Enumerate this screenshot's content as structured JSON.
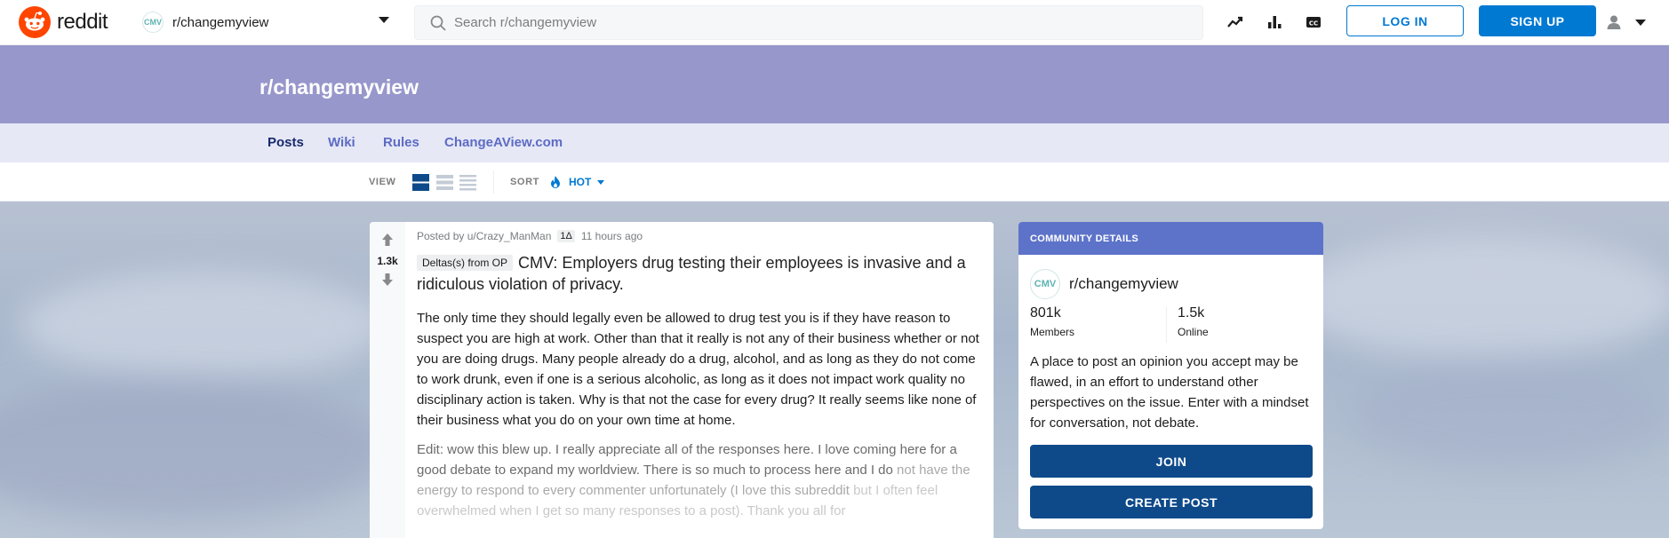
{
  "header": {
    "logo_text": "reddit",
    "community_name": "r/changemyview",
    "community_mini_logo": "CMV",
    "search_placeholder": "Search r/changemyview",
    "icons": [
      "trending-icon",
      "stats-icon",
      "closed-captions-icon"
    ],
    "login_label": "LOG IN",
    "signup_label": "SIGN UP"
  },
  "banner": {
    "title": "r/changemyview",
    "color": "#9797cc"
  },
  "subnav": {
    "tabs": [
      {
        "label": "Posts",
        "active": true
      },
      {
        "label": "Wiki",
        "active": false
      },
      {
        "label": "Rules",
        "active": false
      },
      {
        "label": "ChangeAView.com",
        "active": false
      }
    ]
  },
  "viewbar": {
    "view_label": "VIEW",
    "sort_label": "SORT",
    "sort_value": "HOT"
  },
  "post": {
    "votes": "1.3k",
    "posted_by": "Posted by u/Crazy_ManMan",
    "user_flair": "1Δ",
    "time": "11 hours ago",
    "flair": "Deltas(s) from OP",
    "title": "CMV: Employers drug testing their employees is invasive and a ridiculous violation of privacy.",
    "body_p1": "The only time they should legally even be allowed to drug test you is if they have reason to suspect you are high at work. Other than that it really is not any of their business whether or not you are doing drugs. Many people already do a drug, alcohol, and as long as they do not come to work drunk, even if one is a serious alcoholic, as long as it does not impact work quality no disciplinary action is taken. Why is that not the case for every drug? It really seems like none of their business what you do on your own time at home.",
    "body_p2_a": "Edit: wow this blew up. I really appreciate all of the responses here. I love coming here for a good debate to expand my worldview. There is so much to process here and I do",
    "body_p2_b": "not have the energy to respond to every commenter unfortunately (I love this subreddit",
    "body_p2_c": "but I often feel overwhelmed when I get so many responses to a post). Thank you all for"
  },
  "sidebar": {
    "header": "COMMUNITY DETAILS",
    "header_color": "#5d73c9",
    "logo": "CMV",
    "community_name": "r/changemyview",
    "members_count": "801k",
    "members_label": "Members",
    "online_count": "1.5k",
    "online_label": "Online",
    "description": "A place to post an opinion you accept may be flawed, in an effort to understand other perspectives on the issue. Enter with a mindset for conversation, not debate.",
    "join_label": "JOIN",
    "create_post_label": "CREATE POST"
  }
}
